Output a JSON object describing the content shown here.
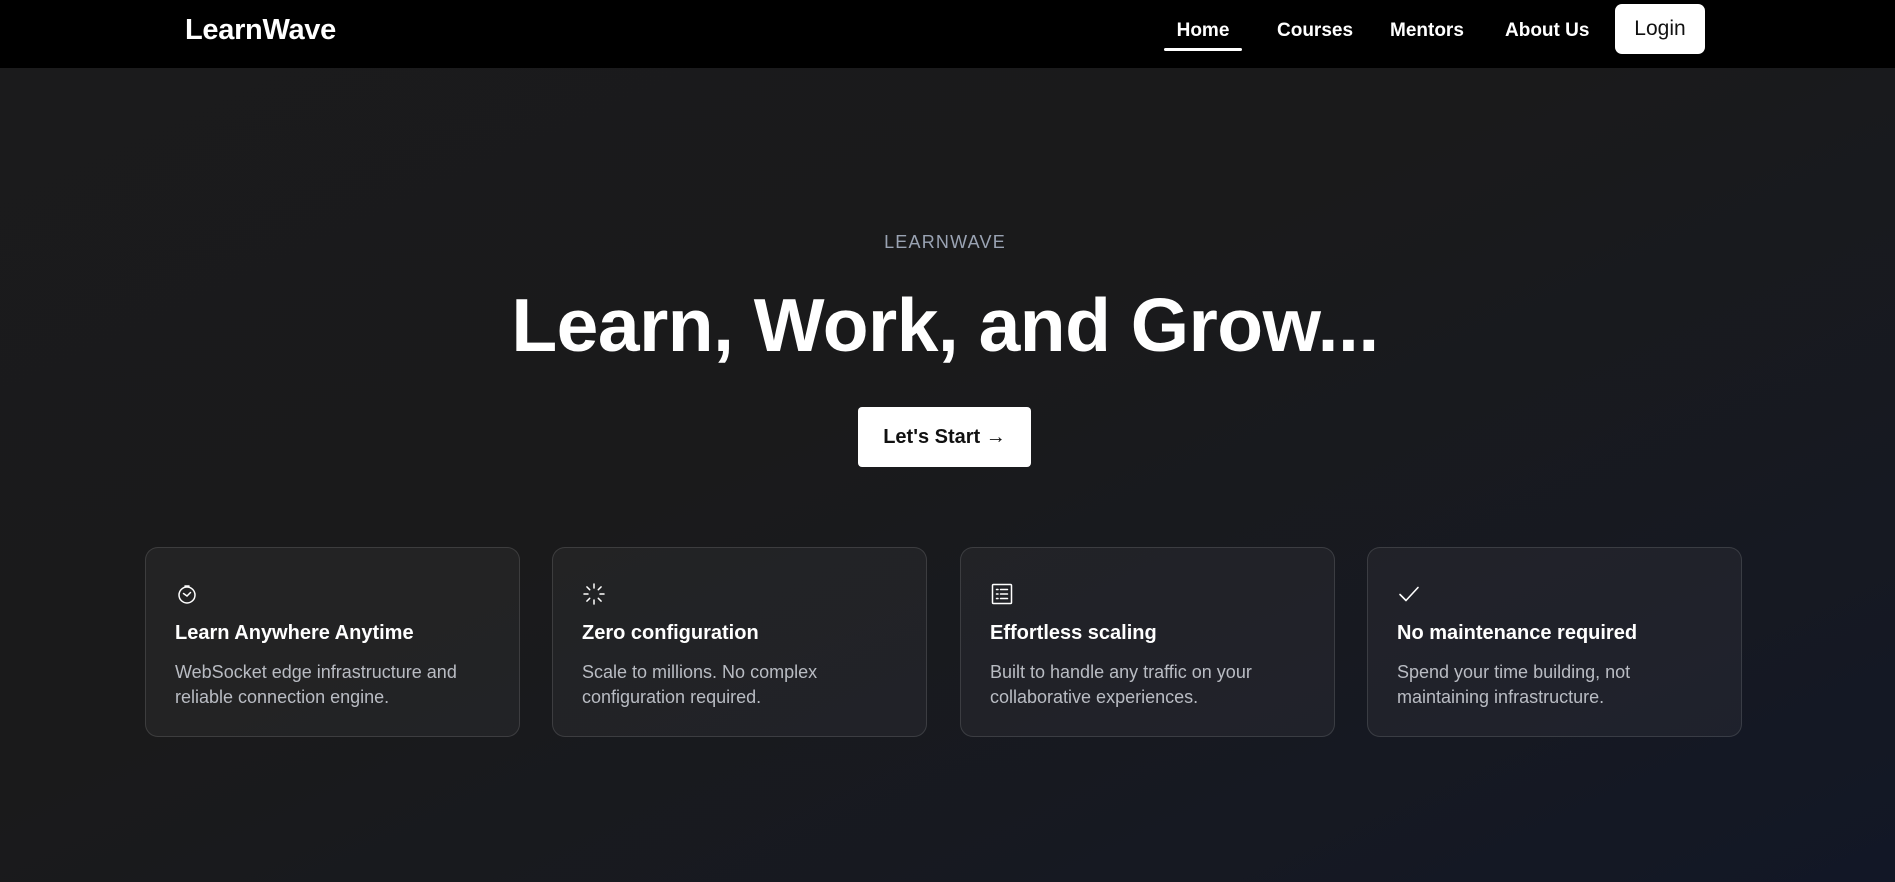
{
  "nav": {
    "brand": "LearnWave",
    "links": [
      "Home",
      "Courses",
      "Mentors",
      "About Us"
    ],
    "active": "Home",
    "login_label": "Login"
  },
  "hero": {
    "eyebrow": "LEARNWAVE",
    "title": "Learn, Work, and Grow...",
    "cta_label": "Let's Start →"
  },
  "features": [
    {
      "icon": "clock-icon",
      "title": "Learn Anywhere Anytime",
      "description": "WebSocket edge infrastructure and reliable connection engine."
    },
    {
      "icon": "loader-icon",
      "title": "Zero configuration",
      "description": "Scale to millions. No complex configuration required."
    },
    {
      "icon": "list-icon",
      "title": "Effortless scaling",
      "description": "Built to handle any traffic on your collaborative experiences."
    },
    {
      "icon": "check-icon",
      "title": "No maintenance required",
      "description": "Spend your time building, not maintaining infrastructure."
    }
  ],
  "colors": {
    "navbar": "#000000",
    "background": "#1a1a1b",
    "accent": "#ffffff",
    "muted_text": "#b9bcc3",
    "eyebrow_text": "#9aa3b3"
  }
}
